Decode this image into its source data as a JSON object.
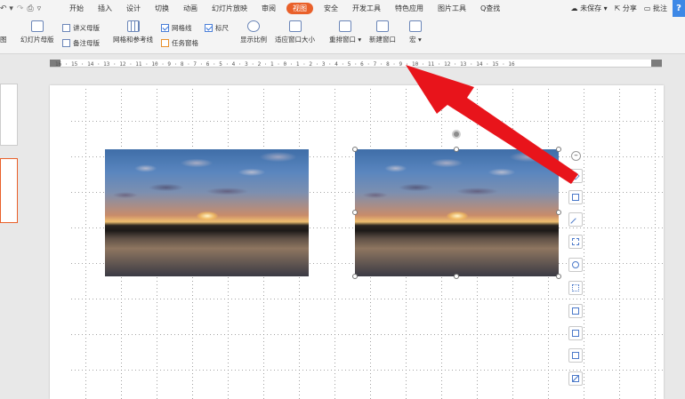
{
  "quick_access": {
    "redo_icon": "redo-icon",
    "print_icon": "print-icon",
    "more_icon": "more-icon"
  },
  "menu_tabs": [
    "开始",
    "插入",
    "设计",
    "切换",
    "动画",
    "幻灯片放映",
    "审阅",
    "视图",
    "安全",
    "开发工具",
    "特色应用",
    "图片工具"
  ],
  "active_tab": "视图",
  "search_label": "Q查找",
  "status": {
    "unsaved": "未保存",
    "share": "分享",
    "comment": "批注"
  },
  "help_glyph": "?",
  "ribbon": {
    "slide_edge": "图",
    "slide_master": "幻灯片母版",
    "handout_master": "讲义母版",
    "notes_master": "备注母版",
    "grid_guides": "网格和参考线",
    "gridlines": "网格线",
    "ruler": "标尺",
    "task_pane": "任务窗格",
    "zoom": "显示比例",
    "fit_window": "适应窗口大小",
    "rearrange": "重排窗口",
    "new_window": "新建窗口",
    "macro": "宏"
  },
  "checkbox_state": {
    "gridlines": true,
    "ruler": true,
    "task_pane": false
  },
  "ruler_labels": "16 · 15 · 14 · 13 · 12 · 11 · 10 · 9 · 8 · 7 · 6 · 5 · 4 · 3 · 2 · 1 · 0 · 1 · 2 · 3 · 4 · 5 · 6 · 7 · 8 · 9 · 10 · 11 · 12 · 13 · 14 · 15 · 16",
  "colors": {
    "accent": "#e9602a",
    "arrow": "#e8141b",
    "help": "#3d88e6"
  },
  "float_tools": [
    "collapse-icon",
    "layers-icon",
    "crop-icon",
    "resize-icon",
    "flip-icon",
    "zoom-icon",
    "effects-icon",
    "replace-icon",
    "copy-icon",
    "save-icon",
    "border-icon"
  ]
}
